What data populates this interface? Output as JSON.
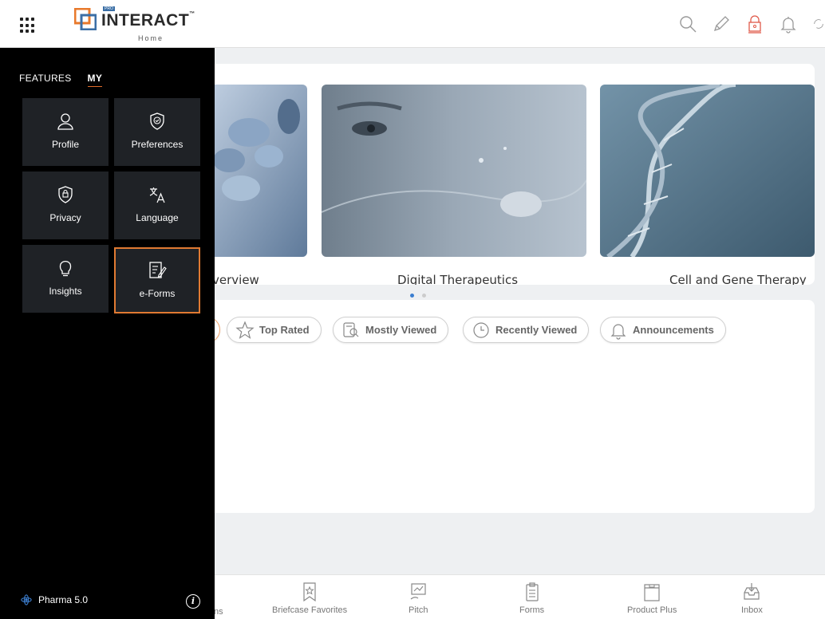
{
  "header": {
    "logo_text": "INTERACT",
    "logo_tm": "™",
    "logo_pro": "PRO",
    "subtitle": "Home",
    "icons": [
      "search-icon",
      "pencil-icon",
      "lock-icon",
      "bell-icon",
      "sync-icon"
    ],
    "lock_color": "#e05a4a"
  },
  "side_panel": {
    "tabs": [
      {
        "label": "FEATURES",
        "active": false
      },
      {
        "label": "MY",
        "active": true
      }
    ],
    "tiles": [
      {
        "label": "Profile",
        "icon": "user-icon"
      },
      {
        "label": "Preferences",
        "icon": "shield-check-icon"
      },
      {
        "label": "Privacy",
        "icon": "shield-lock-icon"
      },
      {
        "label": "Language",
        "icon": "translate-icon"
      },
      {
        "label": "Insights",
        "icon": "lightbulb-icon"
      },
      {
        "label": "e-Forms",
        "icon": "form-edit-icon",
        "selected": true
      }
    ],
    "footer": {
      "app_name": "Pharma 5.0",
      "info_label": "i"
    },
    "accent": "#e07a32"
  },
  "carousel": {
    "slides": [
      {
        "caption": "Overview",
        "visible_caption": "verview"
      },
      {
        "caption": "Digital Therapeutics"
      },
      {
        "caption": "Cell and Gene Therapy"
      }
    ],
    "active_dot": 0,
    "dot_count": 2
  },
  "filters": [
    {
      "label": "Top Rated",
      "icon": "star-icon"
    },
    {
      "label": "Mostly Viewed",
      "icon": "doc-search-icon"
    },
    {
      "label": "Recently Viewed",
      "icon": "clock-icon"
    },
    {
      "label": "Announcements",
      "icon": "bell-icon"
    }
  ],
  "bottom_nav": [
    {
      "label": "ns",
      "icon": ""
    },
    {
      "label": "Briefcase Favorites",
      "icon": "bookmark-star-icon"
    },
    {
      "label": "Pitch",
      "icon": "pitch-icon"
    },
    {
      "label": "Forms",
      "icon": "clipboard-icon"
    },
    {
      "label": "Product Plus",
      "icon": "box-icon"
    },
    {
      "label": "Inbox",
      "icon": "inbox-icon"
    }
  ]
}
